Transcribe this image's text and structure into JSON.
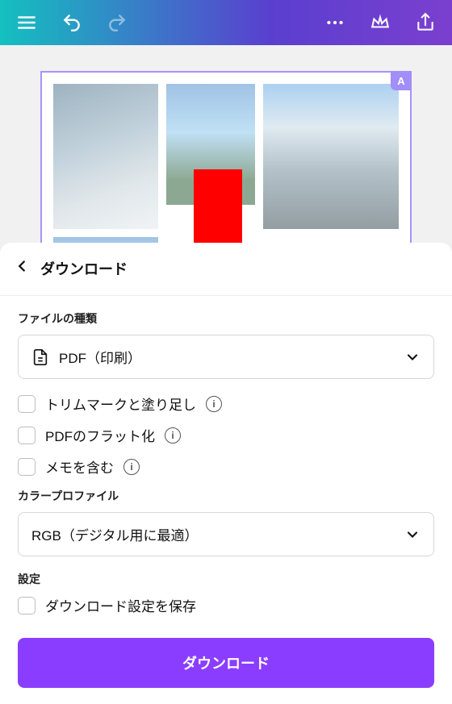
{
  "badge": "A",
  "sheet": {
    "title": "ダウンロード",
    "filetype_label": "ファイルの種類",
    "filetype_value": "PDF（印刷）",
    "options": {
      "trim": "トリムマークと塗り足し",
      "flatten": "PDFのフラット化",
      "memo": "メモを含む"
    },
    "colorprofile_label": "カラープロファイル",
    "colorprofile_value": "RGB（デジタル用に最適）",
    "settings_label": "設定",
    "save_settings": "ダウンロード設定を保存",
    "download_button": "ダウンロード"
  }
}
